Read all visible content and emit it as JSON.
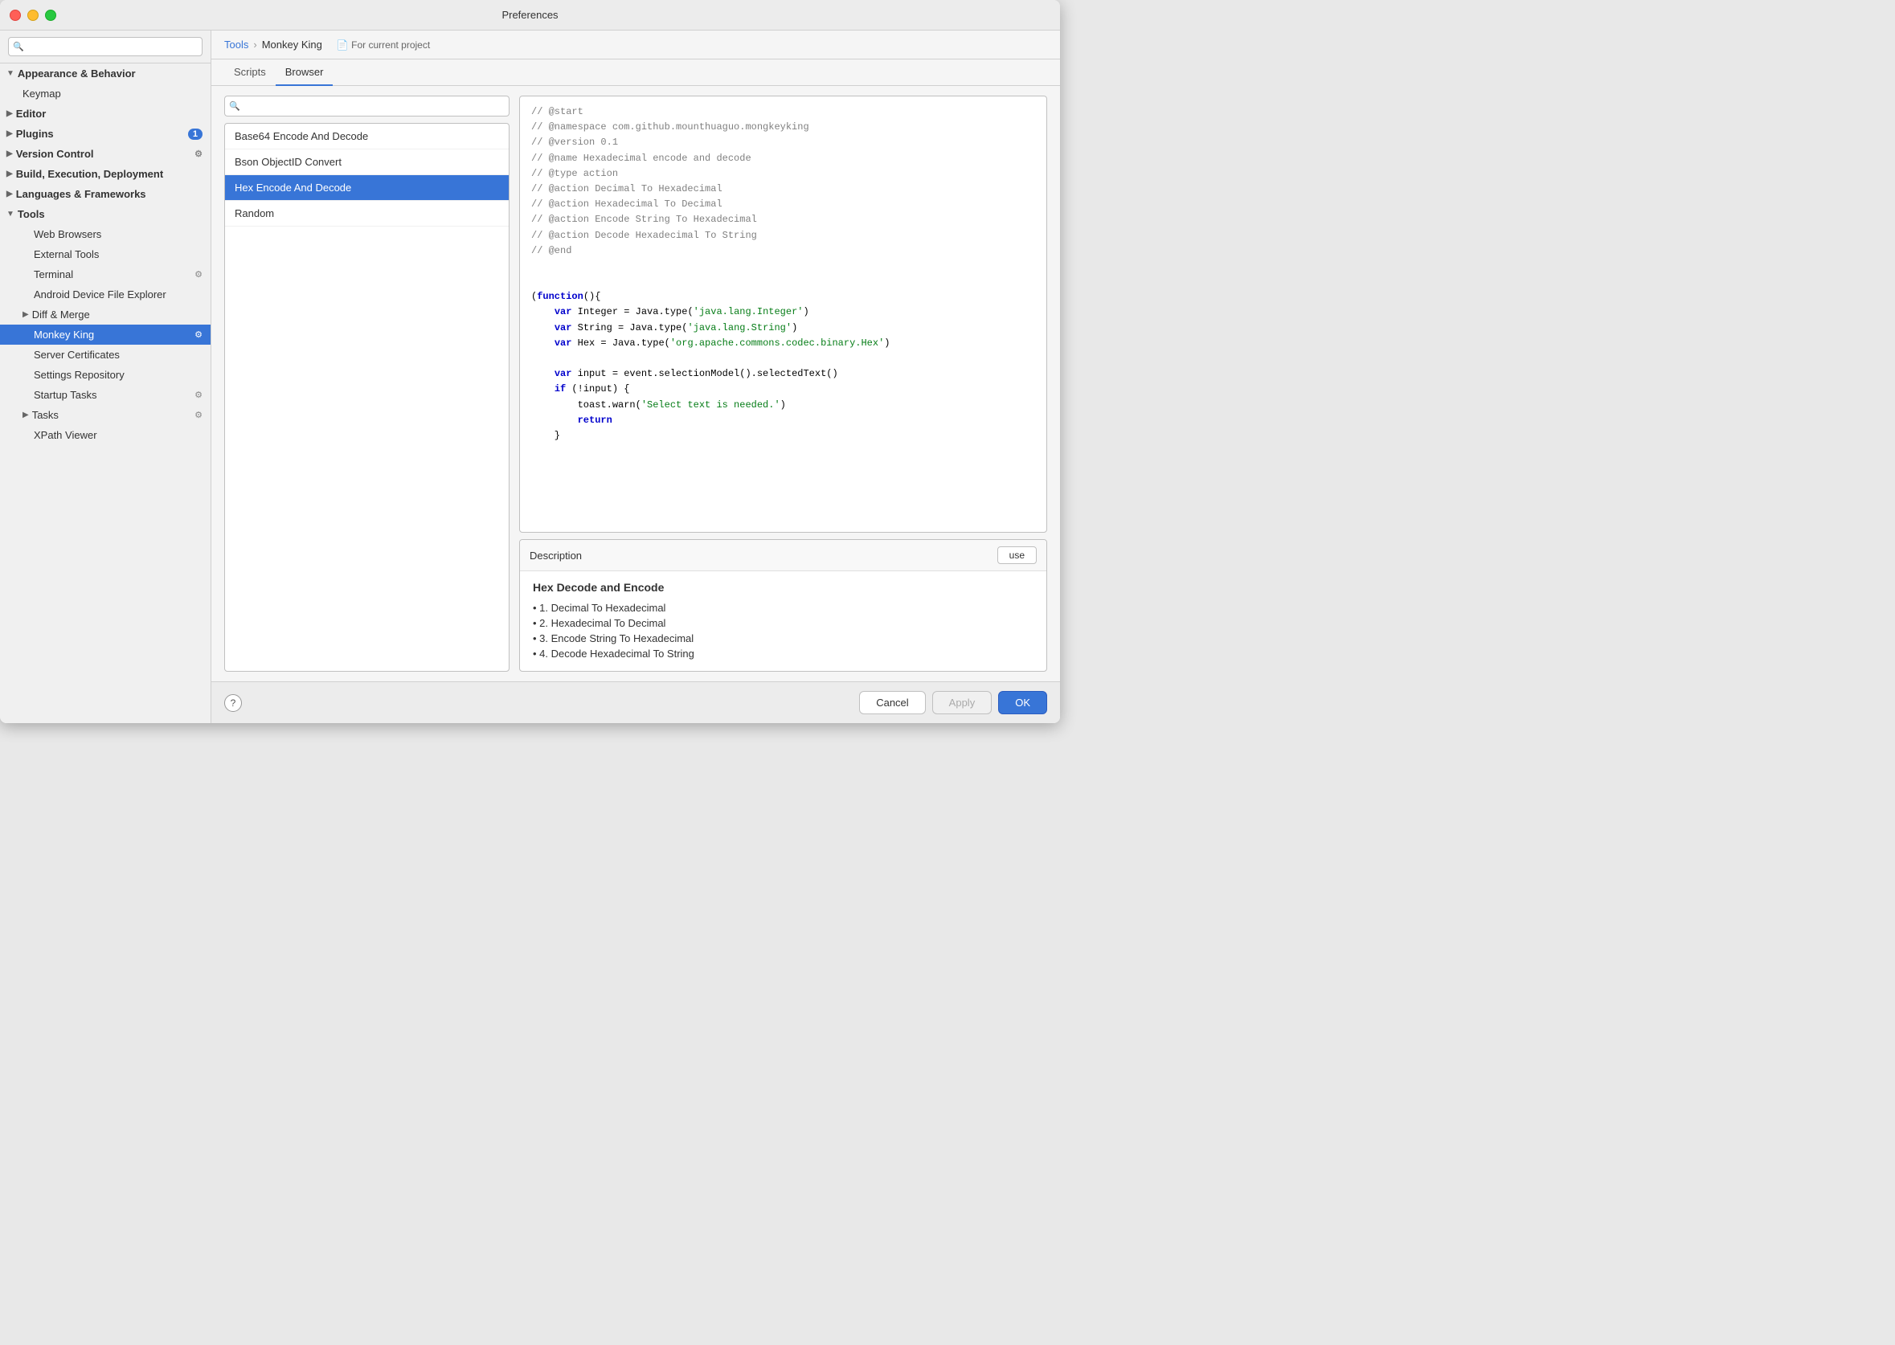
{
  "window": {
    "title": "Preferences"
  },
  "sidebar": {
    "search_placeholder": "🔍",
    "items": [
      {
        "id": "appearance-behavior",
        "label": "Appearance & Behavior",
        "level": "group",
        "expanded": true
      },
      {
        "id": "keymap",
        "label": "Keymap",
        "level": 2
      },
      {
        "id": "editor",
        "label": "Editor",
        "level": "group",
        "expanded": false
      },
      {
        "id": "plugins",
        "label": "Plugins",
        "level": "group",
        "badge": "1"
      },
      {
        "id": "version-control",
        "label": "Version Control",
        "level": "group",
        "has_icon": true
      },
      {
        "id": "build-execution",
        "label": "Build, Execution, Deployment",
        "level": "group"
      },
      {
        "id": "languages-frameworks",
        "label": "Languages & Frameworks",
        "level": "group"
      },
      {
        "id": "tools",
        "label": "Tools",
        "level": "group",
        "expanded": true
      },
      {
        "id": "web-browsers",
        "label": "Web Browsers",
        "level": 3
      },
      {
        "id": "external-tools",
        "label": "External Tools",
        "level": 3
      },
      {
        "id": "terminal",
        "label": "Terminal",
        "level": 3,
        "has_icon": true
      },
      {
        "id": "android-device",
        "label": "Android Device File Explorer",
        "level": 3
      },
      {
        "id": "diff-merge",
        "label": "Diff & Merge",
        "level": "subgroup"
      },
      {
        "id": "monkey-king",
        "label": "Monkey King",
        "level": 3,
        "selected": true,
        "has_icon": true
      },
      {
        "id": "server-certs",
        "label": "Server Certificates",
        "level": 3
      },
      {
        "id": "settings-repo",
        "label": "Settings Repository",
        "level": 3
      },
      {
        "id": "startup-tasks",
        "label": "Startup Tasks",
        "level": 3,
        "has_icon": true
      },
      {
        "id": "tasks",
        "label": "Tasks",
        "level": "subgroup",
        "has_icon": true
      },
      {
        "id": "xpath-viewer",
        "label": "XPath Viewer",
        "level": 3
      }
    ]
  },
  "breadcrumb": {
    "parent": "Tools",
    "current": "Monkey King",
    "project": "For current project"
  },
  "tabs": [
    {
      "id": "scripts",
      "label": "Scripts"
    },
    {
      "id": "browser",
      "label": "Browser",
      "active": true
    }
  ],
  "scripts": {
    "search_placeholder": "🔍",
    "items": [
      {
        "id": "base64",
        "label": "Base64 Encode And Decode"
      },
      {
        "id": "bson",
        "label": "Bson ObjectID Convert"
      },
      {
        "id": "hex",
        "label": "Hex Encode And Decode",
        "selected": true
      },
      {
        "id": "random",
        "label": "Random"
      }
    ]
  },
  "code": {
    "lines": [
      {
        "text": "// @start",
        "type": "comment"
      },
      {
        "text": "// @namespace com.github.mounthuaguo.mongkeyking",
        "type": "comment"
      },
      {
        "text": "// @version 0.1",
        "type": "comment"
      },
      {
        "text": "// @name Hexadecimal encode and decode",
        "type": "comment"
      },
      {
        "text": "// @type action",
        "type": "comment"
      },
      {
        "text": "// @action Decimal To Hexadecimal",
        "type": "comment"
      },
      {
        "text": "// @action Hexadecimal To Decimal",
        "type": "comment"
      },
      {
        "text": "// @action Encode String To Hexadecimal",
        "type": "comment"
      },
      {
        "text": "// @action Decode Hexadecimal To String",
        "type": "comment"
      },
      {
        "text": "// @end",
        "type": "comment"
      },
      {
        "text": "",
        "type": "blank"
      },
      {
        "text": "",
        "type": "blank"
      },
      {
        "text": "(function(){",
        "type": "mixed",
        "parts": [
          {
            "t": "(",
            "c": "default"
          },
          {
            "t": "function",
            "c": "keyword"
          },
          {
            "t": "(){",
            "c": "default"
          }
        ]
      },
      {
        "text": "    var Integer = Java.type('java.lang.Integer')",
        "type": "mixed"
      },
      {
        "text": "    var String = Java.type('java.lang.String')",
        "type": "mixed"
      },
      {
        "text": "    var Hex = Java.type('org.apache.commons.codec.binary.Hex')",
        "type": "mixed"
      },
      {
        "text": "",
        "type": "blank"
      },
      {
        "text": "    var input = event.selectionModel().selectedText()",
        "type": "default"
      },
      {
        "text": "    if (!input) {",
        "type": "default"
      },
      {
        "text": "        toast.warn('Select text is needed.')",
        "type": "mixed"
      },
      {
        "text": "        return",
        "type": "mixed"
      },
      {
        "text": "    }",
        "type": "default"
      },
      {
        "text": "",
        "type": "blank"
      }
    ]
  },
  "description": {
    "label": "Description",
    "use_button": "use",
    "title": "Hex Decode and Encode",
    "items": [
      "1. Decimal To Hexadecimal",
      "2. Hexadecimal To Decimal",
      "3. Encode String To Hexadecimal",
      "4. Decode Hexadecimal To String"
    ]
  },
  "bottom": {
    "cancel_label": "Cancel",
    "apply_label": "Apply",
    "ok_label": "OK"
  }
}
